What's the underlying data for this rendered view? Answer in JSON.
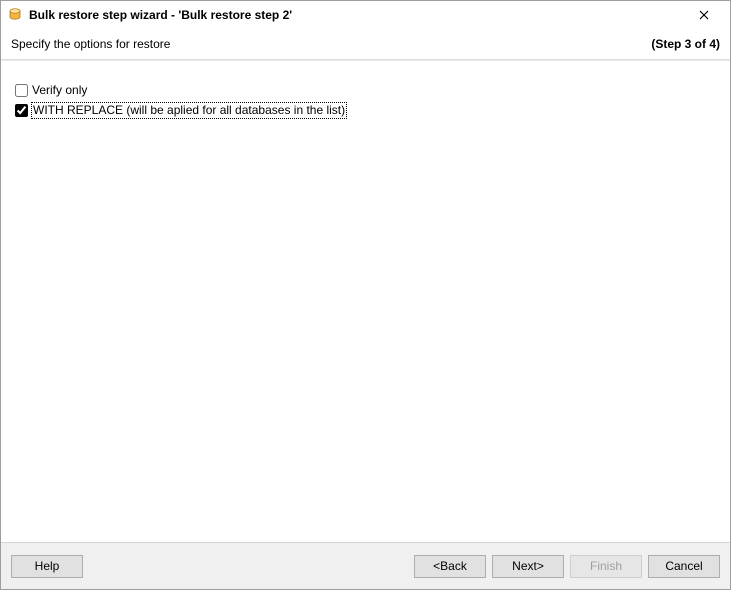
{
  "window": {
    "title": "Bulk restore step wizard - 'Bulk restore step 2'"
  },
  "subheader": {
    "instruction": "Specify the options for restore",
    "step_label": "(Step 3 of 4)"
  },
  "options": {
    "verify_only": {
      "label": "Verify only",
      "checked": false
    },
    "with_replace": {
      "label": "WITH REPLACE (will be aplied for all databases in the list)",
      "checked": true
    }
  },
  "buttons": {
    "help": "Help",
    "back": "<Back",
    "next": "Next>",
    "finish": "Finish",
    "cancel": "Cancel"
  }
}
